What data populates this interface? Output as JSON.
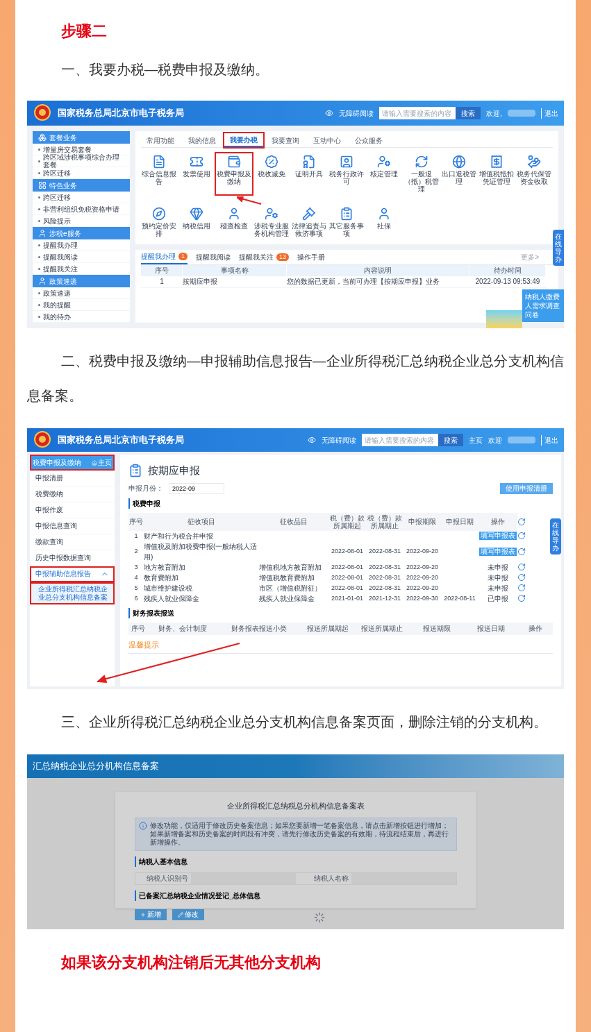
{
  "heading": "步骤二",
  "instruction_1": "一、我要办税—税费申报及缴纳。",
  "screenshot_1": {
    "site_title": "国家税务总局北京市电子税务局",
    "accessibility_link": "无障碍阅读",
    "search": {
      "placeholder": "请输入需要搜索的内容",
      "button": "搜索"
    },
    "welcome": "欢迎,",
    "logout": "退出",
    "sidebar": [
      {
        "title": "套餐业务",
        "items": [
          "增量房交易套餐",
          "跨区域涉税事项综合办理套餐",
          "跨区迁移"
        ]
      },
      {
        "title": "特色业务",
        "items": [
          "跨区迁移",
          "非营利组织免税资格申请",
          "风险提示"
        ]
      },
      {
        "title": "涉税e服务",
        "items": [
          "提醒我办理",
          "提醒我阅读",
          "提醒我关注"
        ]
      },
      {
        "title": "政策速递",
        "items": [
          "政策速递",
          "我的提醒",
          "我的待办"
        ]
      }
    ],
    "main_tabs": [
      {
        "label": "常用功能",
        "selected": false,
        "highlighted": false
      },
      {
        "label": "我的信息",
        "selected": false,
        "highlighted": false
      },
      {
        "label": "我要办税",
        "selected": true,
        "highlighted": true
      },
      {
        "label": "我要查询",
        "selected": false,
        "highlighted": false
      },
      {
        "label": "互动中心",
        "selected": false,
        "highlighted": false
      },
      {
        "label": "公众服务",
        "selected": false,
        "highlighted": false
      }
    ],
    "tiles": [
      {
        "label": "综合信息报告",
        "highlighted": false
      },
      {
        "label": "发票使用",
        "highlighted": false
      },
      {
        "label": "税费申报及缴纳",
        "highlighted": true
      },
      {
        "label": "税收减免",
        "highlighted": false
      },
      {
        "label": "证明开具",
        "highlighted": false
      },
      {
        "label": "税务行政许可",
        "highlighted": false
      },
      {
        "label": "核定管理",
        "highlighted": false
      },
      {
        "label": "一般退（抵）税管理",
        "highlighted": false
      },
      {
        "label": "出口退税管理",
        "highlighted": false
      },
      {
        "label": "增值税抵扣凭证管理",
        "highlighted": false
      },
      {
        "label": "税务代保管资金收取",
        "highlighted": false
      },
      {
        "label": "预约定价安排",
        "highlighted": false
      },
      {
        "label": "纳税信用",
        "highlighted": false
      },
      {
        "label": "稽查检查",
        "highlighted": false
      },
      {
        "label": "涉税专业服务机构管理",
        "highlighted": false
      },
      {
        "label": "法律追责与救济事项",
        "highlighted": false
      },
      {
        "label": "其它服务事项",
        "highlighted": false
      },
      {
        "label": "社保",
        "highlighted": false
      }
    ],
    "reminder_tabs": [
      {
        "label": "提醒我办理",
        "badge": "1",
        "selected": true
      },
      {
        "label": "提醒我阅读",
        "selected": false
      },
      {
        "label": "提醒我关注",
        "badge": "13",
        "selected": false
      },
      {
        "label": "操作手册",
        "selected": false
      }
    ],
    "more_link": "更多>",
    "table": {
      "columns": [
        "序号",
        "事项名称",
        "内容说明",
        "待办时间"
      ],
      "rows": [
        [
          "1",
          "按期应申报",
          "您的数据已更新，当前可办理【按期应申报】业务",
          "2022-09-13 09:53:49"
        ]
      ]
    },
    "guide_button": "在线导办",
    "survey_button": "纳税人缴费人需求调查问卷"
  },
  "instruction_2": "二、税费申报及缴纳—申报辅助信息报告—企业所得税汇总纳税企业总分支机构信息备案。",
  "screenshot_2": {
    "site_title": "国家税务总局北京市电子税务局",
    "accessibility_link": "无障碍阅读",
    "search": {
      "placeholder": "请输入需要搜索的内容",
      "button": "搜索"
    },
    "home_link": "主页",
    "welcome": "欢迎",
    "logout": "退出",
    "sidebar_header": {
      "title": "税费申报及缴纳",
      "home": "主页",
      "highlighted": true
    },
    "sidebar": [
      {
        "label": "申报清册",
        "selected": false,
        "highlighted": false
      },
      {
        "label": "税费缴纳",
        "selected": false,
        "highlighted": false
      },
      {
        "label": "申报作废",
        "selected": false,
        "highlighted": false
      },
      {
        "label": "申报信息查询",
        "selected": false,
        "highlighted": false
      },
      {
        "label": "缴款查询",
        "selected": false,
        "highlighted": false
      },
      {
        "label": "历史申报数据查询",
        "selected": false,
        "highlighted": false
      },
      {
        "label": "申报辅助信息报告",
        "selected": true,
        "highlighted": true,
        "children": [
          {
            "label": "企业所得税汇总纳税企业总分支机构信息备案",
            "selected": true,
            "highlighted": true
          }
        ]
      }
    ],
    "page_title": "按期应申报",
    "month_label": "申报月份：",
    "month_value": "2022-09",
    "checklist_button": "使用申报清册",
    "declare_section": "税费申报",
    "declare_table": {
      "columns": [
        "序号",
        "征收项目",
        "征收品目",
        "税（费）款所属期起",
        "税（费）款所属期止",
        "申报期限",
        "申报日期",
        "操作"
      ],
      "rows": [
        {
          "cells": [
            "1",
            "财产和行为税合并申报",
            "",
            "",
            "",
            "",
            ""
          ],
          "action": "填写申报表",
          "kind": "button"
        },
        {
          "cells": [
            "2",
            "增值税及附加税费申报(一般纳税人适用)",
            "",
            "2022-08-01",
            "2022-08-31",
            "2022-09-20",
            ""
          ],
          "action": "填写申报表",
          "kind": "button"
        },
        {
          "cells": [
            "3",
            "地方教育附加",
            "增值税地方教育附加",
            "2022-08-01",
            "2022-08-31",
            "2022-09-20",
            ""
          ],
          "action": "未申报",
          "kind": "status"
        },
        {
          "cells": [
            "4",
            "教育费附加",
            "增值税教育费附加",
            "2022-08-01",
            "2022-08-31",
            "2022-09-20",
            ""
          ],
          "action": "未申报",
          "kind": "status"
        },
        {
          "cells": [
            "5",
            "城市维护建设税",
            "市区（增值税附征）",
            "2022-08-01",
            "2022-08-31",
            "2022-09-20",
            ""
          ],
          "action": "未申报",
          "kind": "status"
        },
        {
          "cells": [
            "6",
            "残疾人就业保障金",
            "残疾人就业保障金",
            "2021-01-01",
            "2021-12-31",
            "2022-09-30",
            "2022-08-11"
          ],
          "action": "已申报",
          "kind": "status"
        }
      ]
    },
    "finance_section": "财务报表报送",
    "finance_columns": [
      "序号",
      "财务、会计制度",
      "财务报表报送小类",
      "报送所属期起",
      "报送所属期止",
      "报送期限",
      "报送日期",
      "操作"
    ],
    "tips_title": "温馨提示",
    "guide_button": "在线导办"
  },
  "instruction_3": "三、企业所得税汇总纳税企业总分支机构信息备案页面，删除注销的分支机构。",
  "screenshot_3": {
    "header": "汇总纳税企业总分机构信息备案",
    "form_title": "企业所得税汇总纳税总分机构信息备案表",
    "notice": "修改功能，仅适用于修改历史备案信息；如果您要新增一笔备案信息，请点击新增按钮进行增加；如果新增备案和历史备案的时间段有冲突，请先行修改历史备案的有效期，待流程结束后，再进行新增操作。",
    "basic_section": "纳税人基本信息",
    "fields": [
      "纳税人识别号",
      "纳税人名称"
    ],
    "filed_section": "已备案汇总纳税企业情况登记_总体信息",
    "buttons": [
      "新增",
      "修改"
    ]
  },
  "closing_heading": "如果该分支机构注销后无其他分支机构"
}
